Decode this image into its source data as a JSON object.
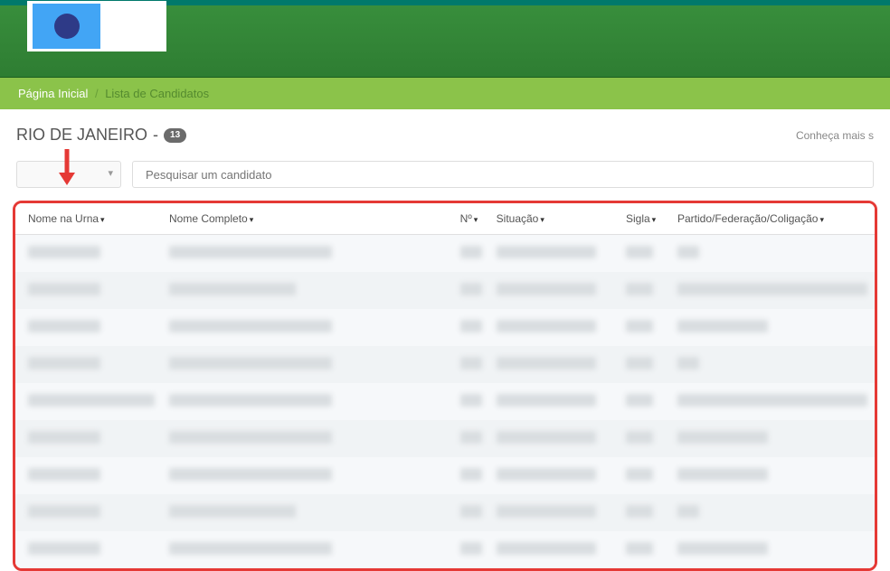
{
  "breadcrumb": {
    "home": "Página Inicial",
    "current": "Lista de Candidatos"
  },
  "title": {
    "region": "RIO DE JANEIRO",
    "separator": " - ",
    "count": "13"
  },
  "more_link": "Conheça mais s",
  "search": {
    "placeholder": "Pesquisar um candidato"
  },
  "columns": {
    "urna": "Nome na Urna",
    "nome": "Nome Completo",
    "numero": "Nº",
    "situacao": "Situação",
    "sigla": "Sigla",
    "partido": "Partido/Federação/Coligação"
  },
  "rows": [
    {
      "urna_w": "bw-sm",
      "nome_w": "bw-lg",
      "part_w": "bw-xs"
    },
    {
      "urna_w": "bw-sm",
      "nome_w": "bw-md",
      "part_w": "bw-pt2"
    },
    {
      "urna_w": "bw-sm",
      "nome_w": "bw-lg",
      "part_w": "bw-pt"
    },
    {
      "urna_w": "bw-sm",
      "nome_w": "bw-lg",
      "part_w": "bw-xs"
    },
    {
      "urna_w": "bw-md",
      "nome_w": "bw-lg",
      "part_w": "bw-pt2"
    },
    {
      "urna_w": "bw-sm",
      "nome_w": "bw-lg",
      "part_w": "bw-pt"
    },
    {
      "urna_w": "bw-sm",
      "nome_w": "bw-lg",
      "part_w": "bw-pt"
    },
    {
      "urna_w": "bw-sm",
      "nome_w": "bw-md",
      "part_w": "bw-xs"
    },
    {
      "urna_w": "bw-sm",
      "nome_w": "bw-lg",
      "part_w": "bw-pt"
    }
  ]
}
